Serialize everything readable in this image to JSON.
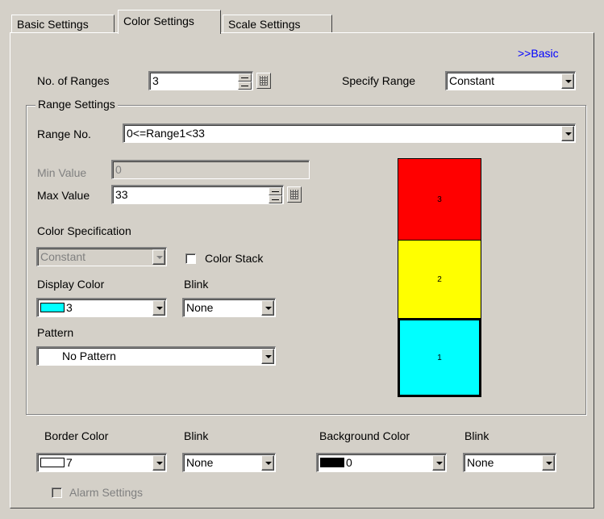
{
  "tabs": [
    {
      "label": "Basic Settings"
    },
    {
      "label": "Color Settings"
    },
    {
      "label": "Scale Settings"
    }
  ],
  "basic_link": ">>Basic",
  "ranges": {
    "label": "No. of Ranges",
    "value": "3"
  },
  "specify_range": {
    "label": "Specify Range",
    "value": "Constant"
  },
  "range_settings": {
    "title": "Range Settings",
    "range_no_label": "Range No.",
    "range_no_value": "0<=Range1<33",
    "min_label": "Min Value",
    "min_value": "0",
    "max_label": "Max Value",
    "max_value": "33",
    "color_spec_label": "Color Specification",
    "color_spec_value": "Constant",
    "color_stack_label": "Color Stack",
    "display_color_label": "Display Color",
    "display_color_value": "3",
    "display_color_hex": "#00ffff",
    "blink_label": "Blink",
    "blink_value": "None",
    "pattern_label": "Pattern",
    "pattern_value": "No Pattern"
  },
  "preview": {
    "bars": [
      {
        "label": "3",
        "color": "#ff0000"
      },
      {
        "label": "2",
        "color": "#ffff00"
      },
      {
        "label": "1",
        "color": "#00ffff"
      }
    ]
  },
  "border": {
    "label": "Border Color",
    "value": "7",
    "color": "#ffffff",
    "blink_label": "Blink",
    "blink_value": "None"
  },
  "background": {
    "label": "Background Color",
    "value": "0",
    "color": "#000000",
    "blink_label": "Blink",
    "blink_value": "None"
  },
  "alarm": {
    "label": "Alarm Settings"
  }
}
